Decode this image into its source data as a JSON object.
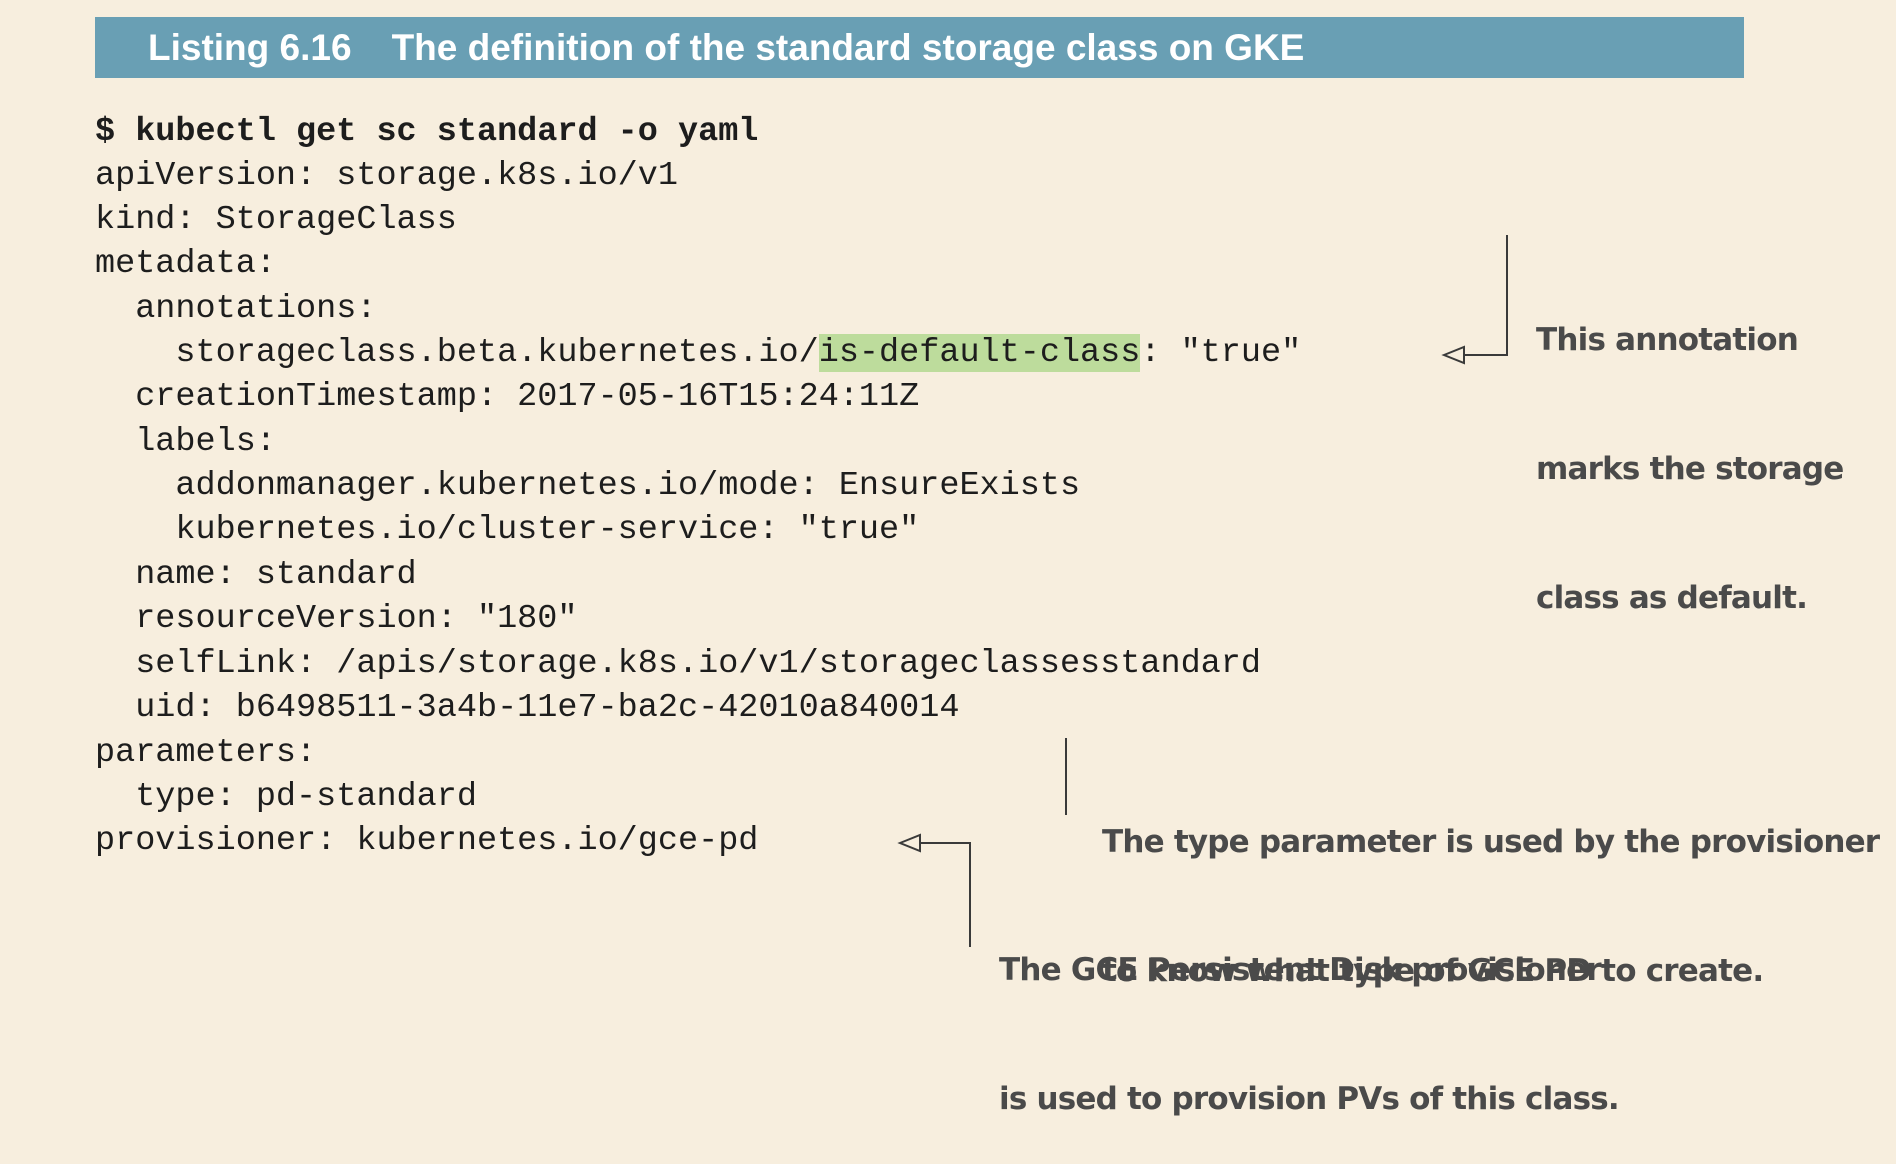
{
  "listing": {
    "number": "Listing 6.16",
    "title": "The definition of the standard storage class on GKE"
  },
  "code": {
    "command": "$ kubectl get sc standard -o yaml",
    "api_version": "apiVersion: storage.k8s.io/v1",
    "kind": "kind: StorageClass",
    "metadata": "metadata:",
    "annotations": "  annotations:",
    "annotation_prefix": "    storageclass.beta.kubernetes.io/",
    "annotation_key_highlight": "is-default-class",
    "annotation_suffix": ": \"true\"",
    "creation_timestamp": "  creationTimestamp: 2017-05-16T15:24:11Z",
    "labels": "  labels:",
    "label_addonmanager": "    addonmanager.kubernetes.io/mode: EnsureExists",
    "label_cluster_service": "    kubernetes.io/cluster-service: \"true\"",
    "name": "  name: standard",
    "resource_version": "  resourceVersion: \"180\"",
    "self_link": "  selfLink: /apis/storage.k8s.io/v1/storageclassesstandard",
    "uid": "  uid: b6498511-3a4b-11e7-ba2c-42010a840014",
    "parameters": "parameters:",
    "type": "  type: pd-standard",
    "provisioner": "provisioner: kubernetes.io/gce-pd"
  },
  "annotations": {
    "default_class": [
      "This annotation",
      "marks the storage",
      "class as default."
    ],
    "type_parameter": [
      "The type parameter is used by the provisioner",
      "to know what type of GCE PD to create."
    ],
    "provisioner": [
      "The GCE Persistent Disk provisioner",
      "is used to provision PVs of this class."
    ]
  },
  "colors": {
    "header_bg": "#699fb4",
    "page_bg": "#f7eede",
    "highlight": "#bddc9c"
  }
}
